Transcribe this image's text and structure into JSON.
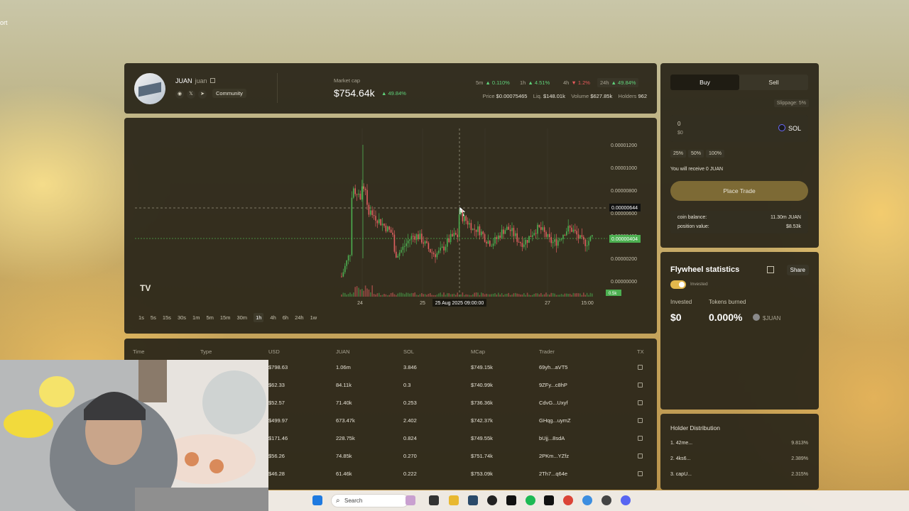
{
  "corner_text": "ort",
  "token": {
    "name": "JUAN",
    "symbol": "juan",
    "community_label": "Community",
    "market_cap_label": "Market cap",
    "market_cap": "$754.64k",
    "market_cap_change": "▲ 49.84%",
    "timeframes": [
      {
        "label": "5m",
        "value": "▲ 0.110%",
        "dir": "up"
      },
      {
        "label": "1h",
        "value": "▲ 4.51%",
        "dir": "up"
      },
      {
        "label": "4h",
        "value": "▼ 1.2%",
        "dir": "down"
      },
      {
        "label": "24h",
        "value": "▲ 49.84%",
        "dir": "up"
      }
    ],
    "price_label": "Price",
    "price": "$0.00075465",
    "liq_label": "Liq.",
    "liq": "$148.01k",
    "volume_label": "Volume",
    "volume": "$627.85k",
    "holders_label": "Holders",
    "holders": "962"
  },
  "chart": {
    "y_ticks": [
      "0.00001200",
      "0.00001000",
      "0.00000800",
      "0.00000600",
      "0.00000400",
      "0.00000200",
      "0.00000000"
    ],
    "crosshair_label": "0.00000644",
    "last_price_label": "0.00000404",
    "volume_badge": "0.5k",
    "x_ticks": [
      "24",
      "25",
      "27",
      "15:00"
    ],
    "crosshair_date": "25 Aug 2025 09:00:00",
    "intervals": [
      "1s",
      "5s",
      "15s",
      "30s",
      "1m",
      "5m",
      "15m",
      "30m",
      "1h",
      "4h",
      "6h",
      "24h",
      "1w"
    ],
    "active_interval": "1h",
    "tv_logo": "TV"
  },
  "trades": {
    "headers": [
      "Time",
      "Type",
      "USD",
      "JUAN",
      "SOL",
      "MCap",
      "Trader",
      "TX"
    ],
    "rows": [
      [
        "$798.63",
        "1.06m",
        "3.846",
        "$749.15k",
        "69yh...aVT5"
      ],
      [
        "$62.33",
        "84.11k",
        "0.3",
        "$740.99k",
        "9ZFy...c8hP"
      ],
      [
        "$52.57",
        "71.40k",
        "0.253",
        "$736.36k",
        "CdvG...Uxyf"
      ],
      [
        "$499.97",
        "673.47k",
        "2.402",
        "$742.37k",
        "GHqg...uymZ"
      ],
      [
        "$171.46",
        "228.75k",
        "0.824",
        "$749.55k",
        "bUjj...8sdA"
      ],
      [
        "$56.26",
        "74.85k",
        "0.270",
        "$751.74k",
        "2PKm...YZfz"
      ],
      [
        "$46.28",
        "61.46k",
        "0.222",
        "$753.09k",
        "2Th7...q64e"
      ]
    ]
  },
  "trade_panel": {
    "buy_label": "Buy",
    "sell_label": "Sell",
    "slippage": "Slippage: 5%",
    "amount_value": "0",
    "amount_usd": "$0",
    "currency": "SOL",
    "percents": [
      "25%",
      "50%",
      "100%"
    ],
    "receive_text": "You will receive 0 JUAN",
    "place_trade_label": "Place Trade",
    "coin_balance_label": "coin balance:",
    "coin_balance": "11.30m JUAN",
    "position_value_label": "position value:",
    "position_value": "$8.53k"
  },
  "flywheel": {
    "title": "Flywheel statistics",
    "share_label": "Share",
    "toggle_label": "Invested",
    "invested_label": "Invested",
    "invested_value": "$0",
    "burned_label": "Tokens burned",
    "burned_value": "0.000%",
    "burned_symbol": "$JUAN"
  },
  "holders": {
    "title": "Holder Distribution",
    "rows": [
      {
        "name": "1. 42me...",
        "pct": "9.813%"
      },
      {
        "name": "2. 4ks6...",
        "pct": "2.389%"
      },
      {
        "name": "3. capU...",
        "pct": "2.315%"
      }
    ]
  },
  "taskbar": {
    "search_placeholder": "Search"
  },
  "colors": {
    "up": "#5fd27a",
    "down": "#e85a5a",
    "panel": "#2a261a",
    "accent": "#7d6a35"
  }
}
